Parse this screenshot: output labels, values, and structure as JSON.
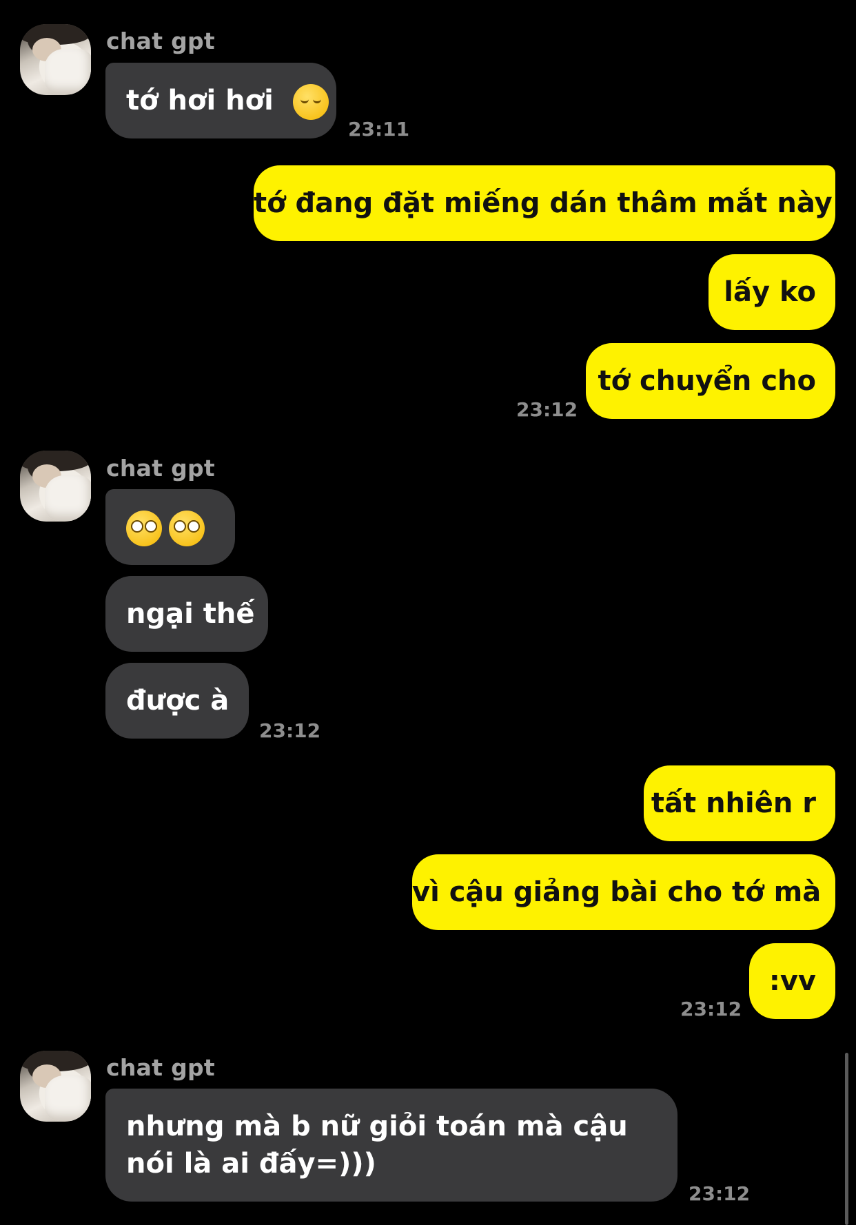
{
  "contact": {
    "name": "chat gpt"
  },
  "messages": [
    {
      "from": "contact",
      "text": "tớ hơi hơi",
      "emoji": "pensive-face-emoji",
      "time": "23:11"
    },
    {
      "from": "me",
      "text": "tớ đang đặt miếng dán thâm mắt này"
    },
    {
      "from": "me",
      "text": "lấy ko"
    },
    {
      "from": "me",
      "text": "tớ chuyển cho",
      "time": "23:12"
    },
    {
      "from": "contact",
      "text": "",
      "emoji": "flushed-face-emoji",
      "emoji_count": 2
    },
    {
      "from": "contact",
      "text": "ngại thế"
    },
    {
      "from": "contact",
      "text": "được à",
      "time": "23:12"
    },
    {
      "from": "me",
      "text": "tất nhiên r"
    },
    {
      "from": "me",
      "text": "vì cậu giảng bài cho tớ mà"
    },
    {
      "from": "me",
      "text": ":vv",
      "time": "23:12"
    },
    {
      "from": "contact",
      "text": "nhưng mà b nữ giỏi toán mà cậu nói là ai đấy=)))",
      "time": "23:12"
    }
  ],
  "colors": {
    "background": "#000000",
    "incoming_bubble": "#3a3a3c",
    "outgoing_bubble": "#fef200",
    "sender_name": "#a3a3a3",
    "timestamp": "#8e8e8e"
  }
}
